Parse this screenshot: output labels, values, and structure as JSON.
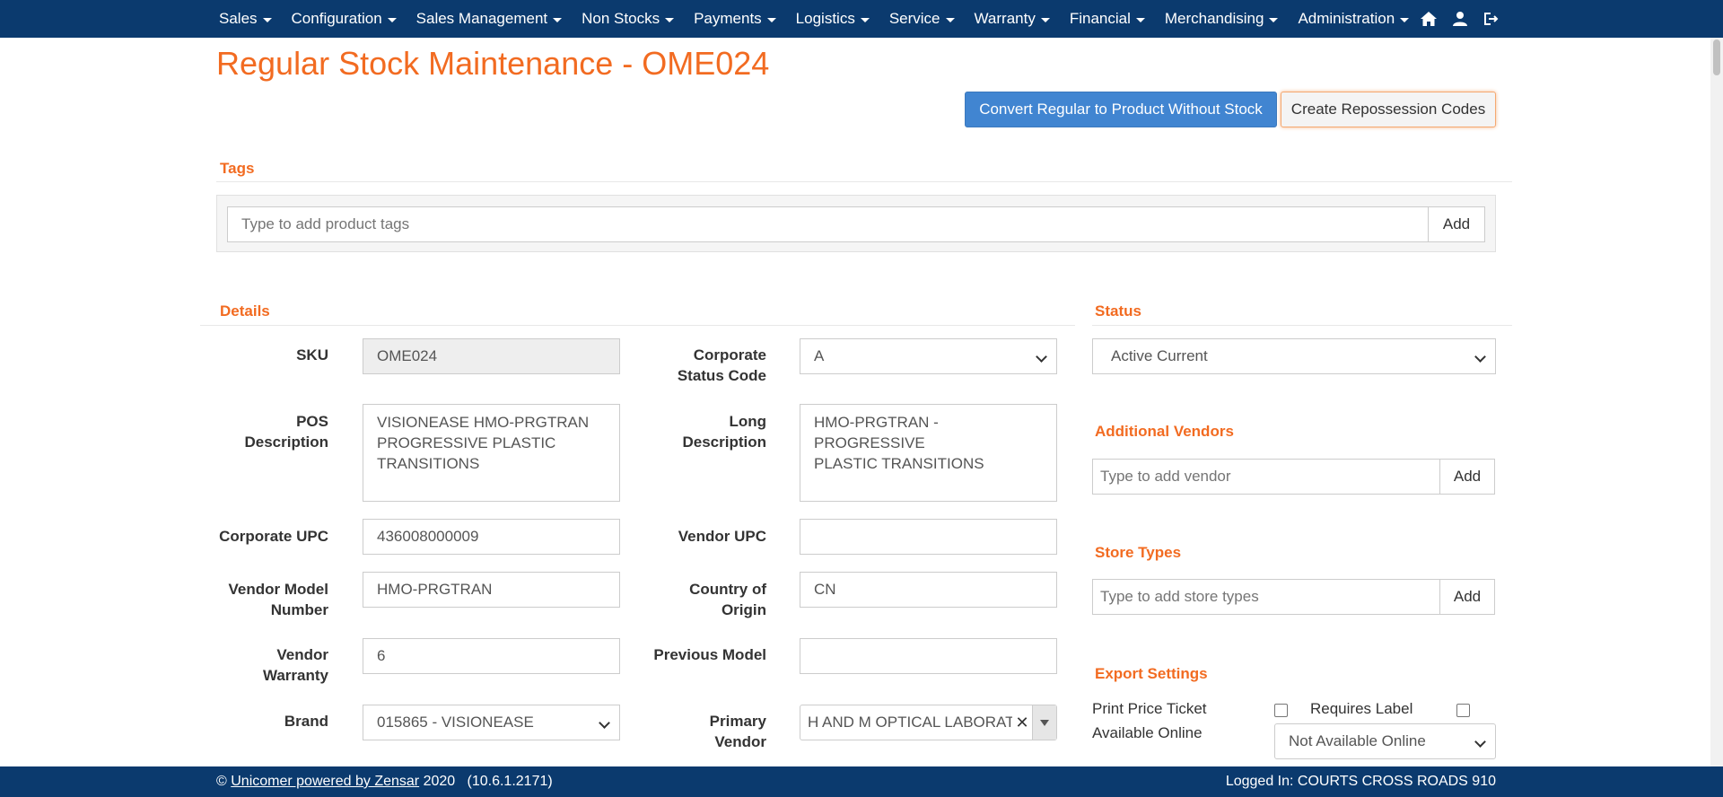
{
  "nav": {
    "menu": [
      "Sales",
      "Configuration",
      "Sales Management",
      "Non Stocks",
      "Payments",
      "Logistics",
      "Service",
      "Warranty",
      "Financial",
      "Merchandising",
      "Administration"
    ],
    "icons": [
      "home-icon",
      "user-icon",
      "logout-icon"
    ],
    "bar_color": "#0b3a6e"
  },
  "page": {
    "title": "Regular Stock Maintenance - OME024",
    "accent_color": "#f26b21"
  },
  "actions": {
    "convert_label": "Convert Regular to Product Without Stock",
    "repossession_label": "Create Repossession Codes"
  },
  "tags": {
    "heading": "Tags",
    "placeholder": "Type to add product tags",
    "add_label": "Add"
  },
  "details": {
    "heading": "Details",
    "sku": {
      "label": "SKU",
      "value": "OME024"
    },
    "corporate_status": {
      "label_1": "Corporate",
      "label_2": "Status Code",
      "value": "A"
    },
    "pos_description": {
      "label_1": "POS",
      "label_2": "Description",
      "lines": [
        "VISIONEASE HMO-PRGTRAN",
        "PROGRESSIVE PLASTIC",
        "TRANSITIONS"
      ]
    },
    "long_description": {
      "label_1": "Long",
      "label_2": "Description",
      "lines": [
        "HMO-PRGTRAN - PROGRESSIVE",
        "PLASTIC TRANSITIONS"
      ]
    },
    "corporate_upc": {
      "label": "Corporate UPC",
      "value": "436008000009"
    },
    "vendor_upc": {
      "label": "Vendor UPC",
      "value": ""
    },
    "vendor_model": {
      "label_1": "Vendor Model",
      "label_2": "Number",
      "value": "HMO-PRGTRAN"
    },
    "country_of_origin": {
      "label_1": "Country of",
      "label_2": "Origin",
      "value": "CN"
    },
    "vendor_warranty": {
      "label_1": "Vendor",
      "label_2": "Warranty",
      "value": "6"
    },
    "previous_model": {
      "label": "Previous Model",
      "value": ""
    },
    "brand": {
      "label": "Brand",
      "value": "015865 - VISIONEASE"
    },
    "primary_vendor": {
      "label_1": "Primary",
      "label_2": "Vendor",
      "value": "H AND M OPTICAL LABORATO"
    }
  },
  "status": {
    "heading": "Status",
    "value": "Active Current"
  },
  "additional_vendors": {
    "heading": "Additional Vendors",
    "placeholder": "Type to add vendor",
    "add_label": "Add"
  },
  "store_types": {
    "heading": "Store Types",
    "placeholder": "Type to add store types",
    "add_label": "Add"
  },
  "export_settings": {
    "heading": "Export Settings",
    "print_price_ticket": "Print Price Ticket",
    "requires_label": "Requires Label",
    "available_online": "Available Online",
    "available_online_value": "Not Available Online"
  },
  "footer": {
    "copyright": "©",
    "link_text": "Unicomer powered by Zensar",
    "year_version": "2020   (10.6.1.2171)",
    "logged_in": "Logged In: COURTS CROSS ROADS 910"
  }
}
